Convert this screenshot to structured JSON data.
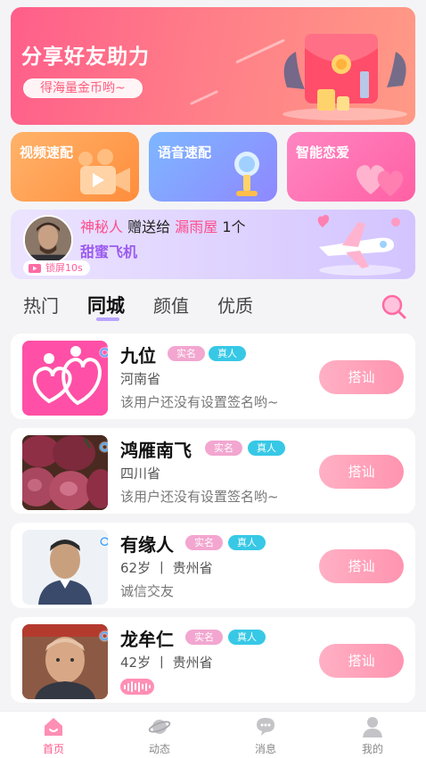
{
  "banner": {
    "title": "分享好友助力",
    "subtitle": "得海量金币哟~"
  },
  "features": [
    {
      "label": "视频速配",
      "icon": "video-camera-icon"
    },
    {
      "label": "语音速配",
      "icon": "microphone-icon"
    },
    {
      "label": "智能恋爱",
      "icon": "hearts-icon"
    }
  ],
  "gift_broadcast": {
    "sender": "神秘人",
    "action": "赠送给",
    "receiver": "漏雨屋",
    "count": "1个",
    "gift_name": "甜蜜飞机",
    "badge": "锁屏10s"
  },
  "tabs": [
    {
      "label": "热门"
    },
    {
      "label": "同城"
    },
    {
      "label": "颜值"
    },
    {
      "label": "优质"
    }
  ],
  "active_tab": "同城",
  "users": [
    {
      "name": "九位",
      "gender": "♂",
      "tag_verified": "实名",
      "tag_real": "真人",
      "line2": "河南省",
      "line3": "该用户还没有设置签名哟~",
      "button": "搭讪"
    },
    {
      "name": "鸿雁南飞",
      "gender": "♂",
      "tag_verified": "实名",
      "tag_real": "真人",
      "line2": "四川省",
      "line3": "该用户还没有设置签名哟~",
      "button": "搭讪"
    },
    {
      "name": "有缘人",
      "gender": "♂",
      "tag_verified": "实名",
      "tag_real": "真人",
      "line2": "62岁 丨 贵州省",
      "line3": "诚信交友",
      "button": "搭讪"
    },
    {
      "name": "龙牟仁",
      "gender": "♂",
      "tag_verified": "实名",
      "tag_real": "真人",
      "line2": "42岁 丨 贵州省",
      "line3": "",
      "button": "搭讪"
    }
  ],
  "bottom_nav": [
    {
      "label": "首页",
      "icon": "home-icon"
    },
    {
      "label": "动态",
      "icon": "planet-icon"
    },
    {
      "label": "消息",
      "icon": "chat-bubble-icon"
    },
    {
      "label": "我的",
      "icon": "profile-icon"
    }
  ],
  "colors": {
    "accent_pink": "#ff5c8c",
    "accent_purple": "#9b5bf0",
    "tag_verified": "#f2a6d0",
    "tag_real": "#37c8e6"
  }
}
